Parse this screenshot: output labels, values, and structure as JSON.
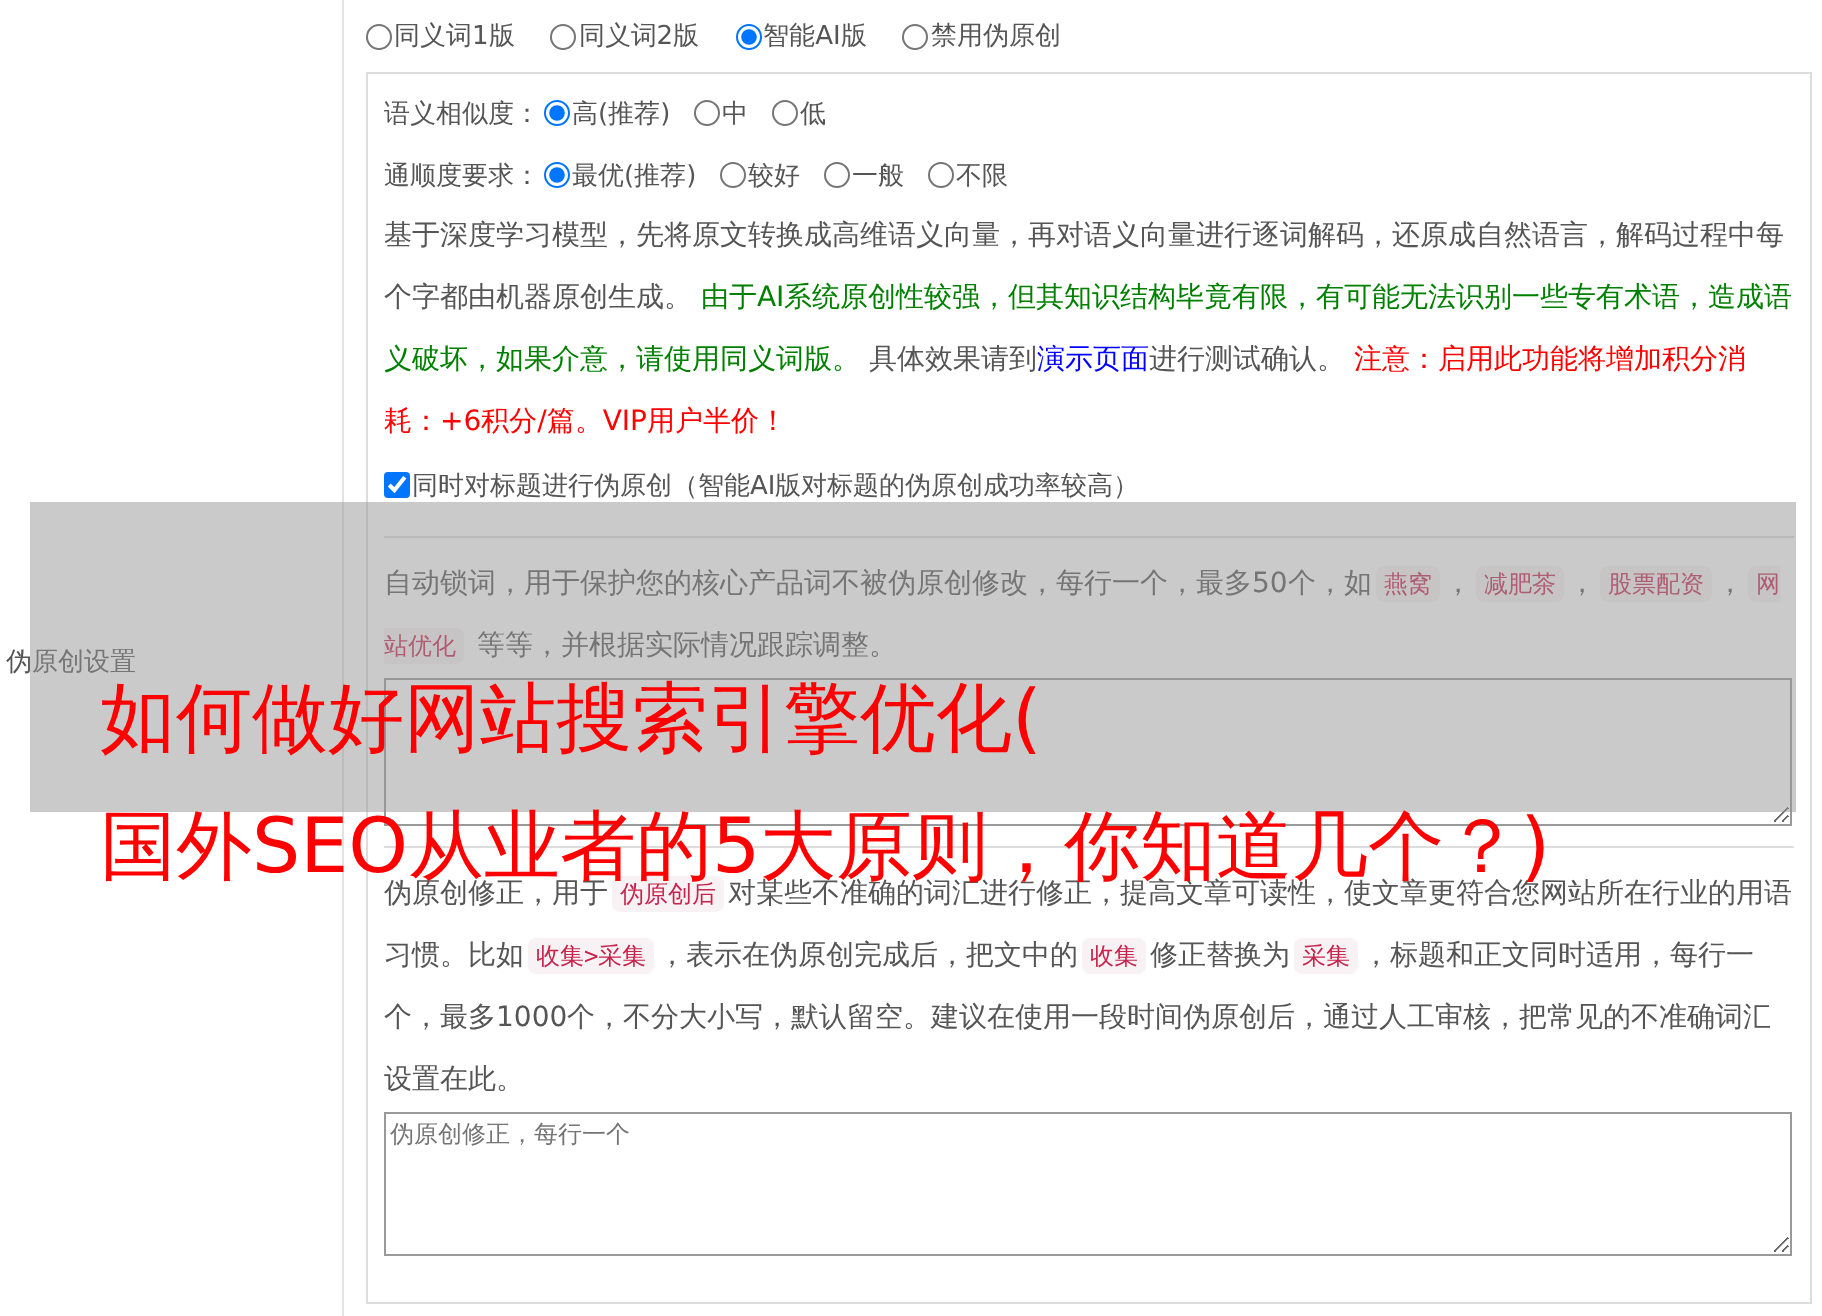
{
  "sidebar_label": "伪原创设置",
  "modes": [
    {
      "label": "同义词1版",
      "selected": false
    },
    {
      "label": "同义词2版",
      "selected": false
    },
    {
      "label": "智能AI版",
      "selected": true
    },
    {
      "label": "禁用伪原创",
      "selected": false
    }
  ],
  "ai_settings": {
    "similarity": {
      "label": "语义相似度：",
      "options": [
        {
          "label": "高(推荐)",
          "selected": true
        },
        {
          "label": "中",
          "selected": false
        },
        {
          "label": "低",
          "selected": false
        }
      ]
    },
    "fluency": {
      "label": "通顺度要求：",
      "options": [
        {
          "label": "最优(推荐)",
          "selected": true
        },
        {
          "label": "较好",
          "selected": false
        },
        {
          "label": "一般",
          "selected": false
        },
        {
          "label": "不限",
          "selected": false
        }
      ]
    },
    "description": [
      {
        "kind": "text",
        "text": "基于深度学习模型，先将原文转换成高维语义向量，再对语义向量进行逐词解码，还原成自然语言，解码过程中每个字都由机器原创生成。 "
      },
      {
        "kind": "note",
        "text": "由于AI系统原创性较强，但其知识结构毕竟有限，有可能无法识别一些专有术语，造成语义破坏，如果介意，请使用同义词版。"
      },
      {
        "kind": "text",
        "text": " 具体效果请到"
      },
      {
        "kind": "link",
        "text": "演示页面"
      },
      {
        "kind": "text",
        "text": "进行测试确认。 "
      },
      {
        "kind": "warning",
        "text": "注意：启用此功能将增加积分消耗：+6积分/篇。VIP用户半价！"
      }
    ],
    "title_option": {
      "label": "同时对标题进行伪原创（智能AI版对标题的伪原创成功率较高）",
      "checked": true
    }
  },
  "lock_words": {
    "description": [
      {
        "kind": "text",
        "text": "自动锁词，用于保护您的核心产品词不被伪原创修改，每行一个，最多50个，如"
      },
      {
        "kind": "code",
        "text": "燕窝"
      },
      {
        "kind": "text",
        "text": "，"
      },
      {
        "kind": "code",
        "text": "减肥茶"
      },
      {
        "kind": "text",
        "text": "，"
      },
      {
        "kind": "code",
        "text": "股票配资"
      },
      {
        "kind": "text",
        "text": "，"
      },
      {
        "kind": "code",
        "text": "网站优化"
      },
      {
        "kind": "text",
        "text": " 等等，并根据实际情况跟踪调整。"
      }
    ]
  },
  "corrections": {
    "description": [
      {
        "kind": "text",
        "text": "伪原创修正，用于"
      },
      {
        "kind": "code",
        "text": "伪原创后"
      },
      {
        "kind": "text",
        "text": "对某些不准确的词汇进行修正，提高文章可读性，使文章更符合您网站所在行业的用语习惯。比如"
      },
      {
        "kind": "code",
        "text": "收集>采集"
      },
      {
        "kind": "text",
        "text": "，表示在伪原创完成后，把文中的"
      },
      {
        "kind": "code",
        "text": "收集"
      },
      {
        "kind": "text",
        "text": "修正替换为"
      },
      {
        "kind": "code",
        "text": "采集"
      },
      {
        "kind": "text",
        "text": "，标题和正文同时适用，每行一个，最多1000个，不分大小写，默认留空。建议在使用一段时间伪原创后，通过人工审核，把常见的不准确词汇设置在此。"
      }
    ],
    "placeholder": "伪原创修正，每行一个"
  },
  "overlay": {
    "title_lines": [
      "如何做好网站搜索引擎优化(",
      "国外SEO从业者的5大原则，你知道几个？)"
    ]
  }
}
